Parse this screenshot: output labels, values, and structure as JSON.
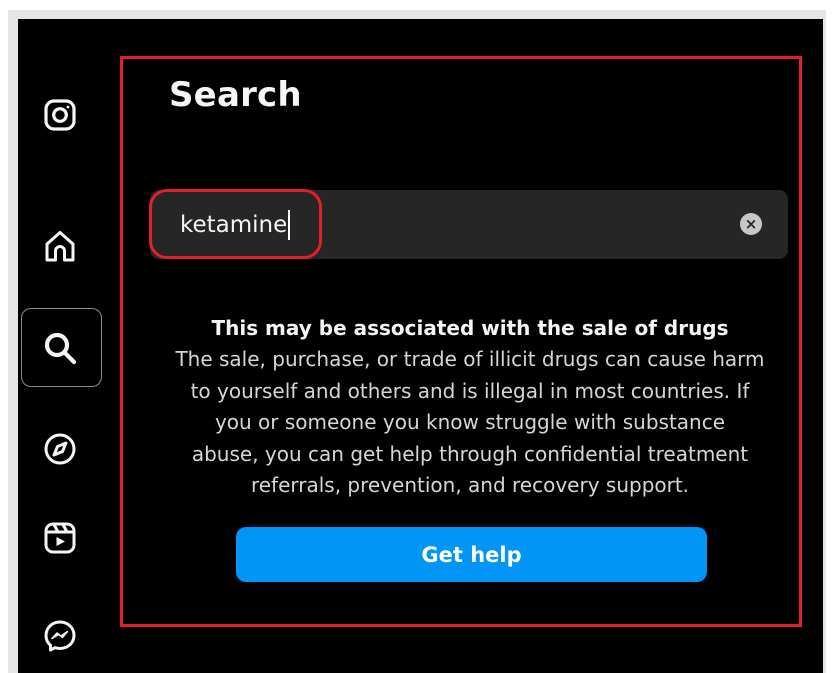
{
  "sidebar": {
    "items": [
      {
        "name": "instagram-logo-icon",
        "label": "Instagram"
      },
      {
        "name": "home-icon",
        "label": "Home"
      },
      {
        "name": "search-icon",
        "label": "Search",
        "active": true
      },
      {
        "name": "explore-compass-icon",
        "label": "Explore"
      },
      {
        "name": "reels-icon",
        "label": "Reels"
      },
      {
        "name": "messenger-icon",
        "label": "Messages"
      }
    ]
  },
  "search_panel": {
    "title": "Search",
    "query": "ketamine",
    "clear_icon": "×"
  },
  "warning": {
    "title": "This may be associated with the sale of drugs",
    "body_lines": [
      "The sale, purchase, or trade of illicit drugs can cause harm",
      "to yourself and others and is illegal in most countries. If",
      "you or someone you know struggle with substance",
      "abuse, you can get help through confidential treatment",
      "referrals, prevention, and recovery support."
    ]
  },
  "help_button": {
    "label": "Get help"
  },
  "colors": {
    "background": "#000000",
    "search_bar": "#262626",
    "accent_blue": "#0095f6",
    "annotation_red": "#e3202a",
    "text": "#f5f5f5"
  }
}
